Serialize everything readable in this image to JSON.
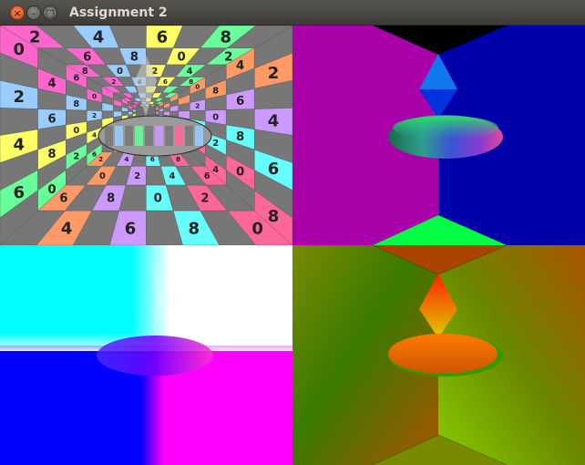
{
  "window": {
    "title": "Assignment 2",
    "buttons": {
      "close_glyph": "×",
      "minimize_glyph": "–",
      "maximize_glyph": "□"
    }
  },
  "viewports": {
    "textured": {
      "palette": [
        "#ff66cc",
        "#99ccff",
        "#ffff66",
        "#66ff99",
        "#ff9966",
        "#cc99ff",
        "#66ffff",
        "#ff6699"
      ],
      "checker_gray": "#777777",
      "glyphs": [
        "0",
        "1",
        "2",
        "3",
        "4",
        "5",
        "6",
        "7",
        "8",
        "9"
      ]
    },
    "normals": {
      "left_wall": "#aa00aa",
      "right_wall": "#0000aa",
      "ceiling": "#000000",
      "floor": "#00ff44"
    },
    "blended": {
      "top_left": "#00ffff",
      "top_right": "#ffffff",
      "bottom_left": "#0000ff",
      "bottom_right": "#ff00ff"
    },
    "gradient": {
      "left_wall": "#669900",
      "right_wall": "#996600",
      "ceiling": "#aa4400",
      "floor": "#889900"
    }
  }
}
